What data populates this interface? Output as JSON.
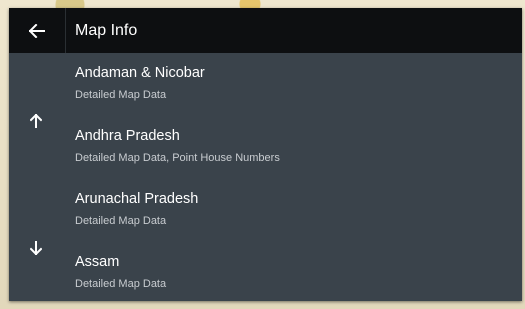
{
  "header": {
    "title": "Map Info"
  },
  "icons": {
    "back": "arrow-left-icon",
    "scroll_up": "arrow-up-icon",
    "scroll_down": "arrow-down-icon"
  },
  "colors": {
    "header_bg": "#0d0f11",
    "panel_bg": "#3a434b",
    "primary_text": "#ffffff",
    "secondary_text": "#c8ccd0"
  },
  "regions": [
    {
      "name": "Andaman & Nicobar",
      "detail": "Detailed Map Data"
    },
    {
      "name": "Andhra Pradesh",
      "detail": "Detailed Map Data, Point House Numbers"
    },
    {
      "name": "Arunachal Pradesh",
      "detail": "Detailed Map Data"
    },
    {
      "name": "Assam",
      "detail": "Detailed Map Data"
    }
  ]
}
